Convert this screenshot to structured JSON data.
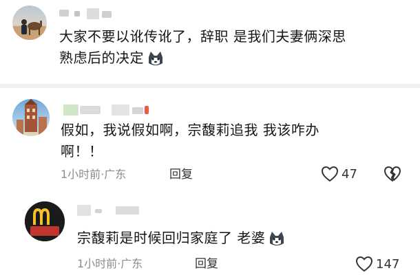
{
  "comments": [
    {
      "text_line1": "大家不要以讹传讹了，辞职 是我们夫妻俩深思",
      "text_line2": "熟虑后的决定",
      "emoji": "husky-face-icon"
    },
    {
      "text_line1": "假如，我说假如啊，宗馥莉追我 我该咋办",
      "text_line2": "啊！！",
      "time": "1小时前",
      "location": "广东",
      "reply_label": "回复",
      "likes": "47"
    },
    {
      "text_line1": "宗馥莉是时候回归家庭了 老婆",
      "emoji": "husky-face-icon",
      "time": "1小时前",
      "location": "广东",
      "reply_label": "回复",
      "likes": "147"
    }
  ],
  "meta_separator": "·",
  "colors": {
    "meta": "#8b8b8b",
    "divider": "#f1f1f1",
    "text": "#161616"
  }
}
